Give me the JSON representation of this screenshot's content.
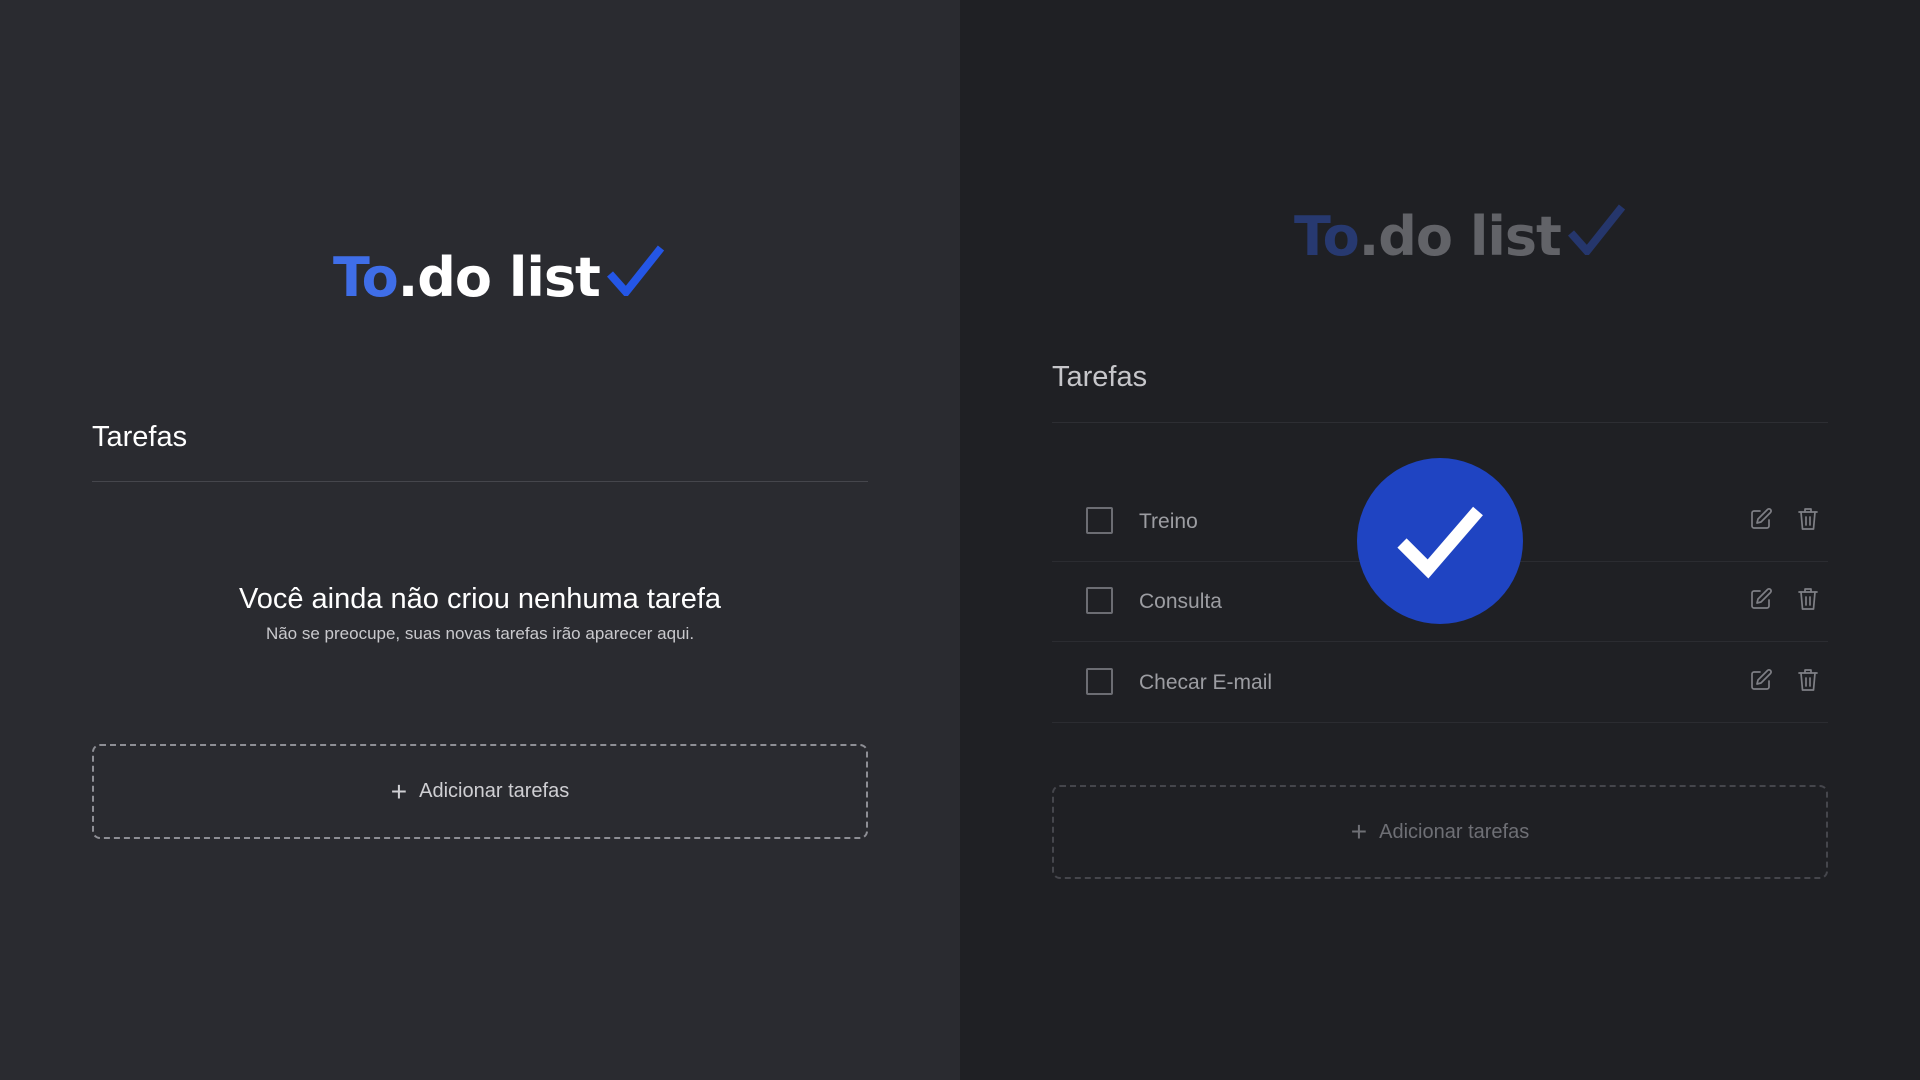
{
  "left": {
    "logo": {
      "to": "To",
      "rest": ".do list"
    },
    "section_title": "Tarefas",
    "empty_title": "Você ainda não criou nenhuma tarefa",
    "empty_subtitle": "Não se preocupe, suas novas tarefas irão aparecer aqui.",
    "add_button": {
      "icon": "plus-icon",
      "label": "Adicionar tarefas"
    }
  },
  "right": {
    "logo": {
      "to": "To",
      "rest": ".do list"
    },
    "section_title": "Tarefas",
    "tasks": [
      {
        "label": "Treino",
        "checked": false
      },
      {
        "label": "Consulta",
        "checked": false
      },
      {
        "label": "Checar E-mail",
        "checked": false
      }
    ],
    "row_icons": [
      "edit-icon",
      "trash-icon"
    ],
    "add_button": {
      "icon": "plus-icon",
      "label": "Adicionar tarefas"
    },
    "badge_icon": "checkmark-icon"
  },
  "colors": {
    "accent": "#3f6ee8",
    "badge": "#1f44c2",
    "left_bg": "#2a2b30",
    "right_bg": "#1f2024"
  }
}
